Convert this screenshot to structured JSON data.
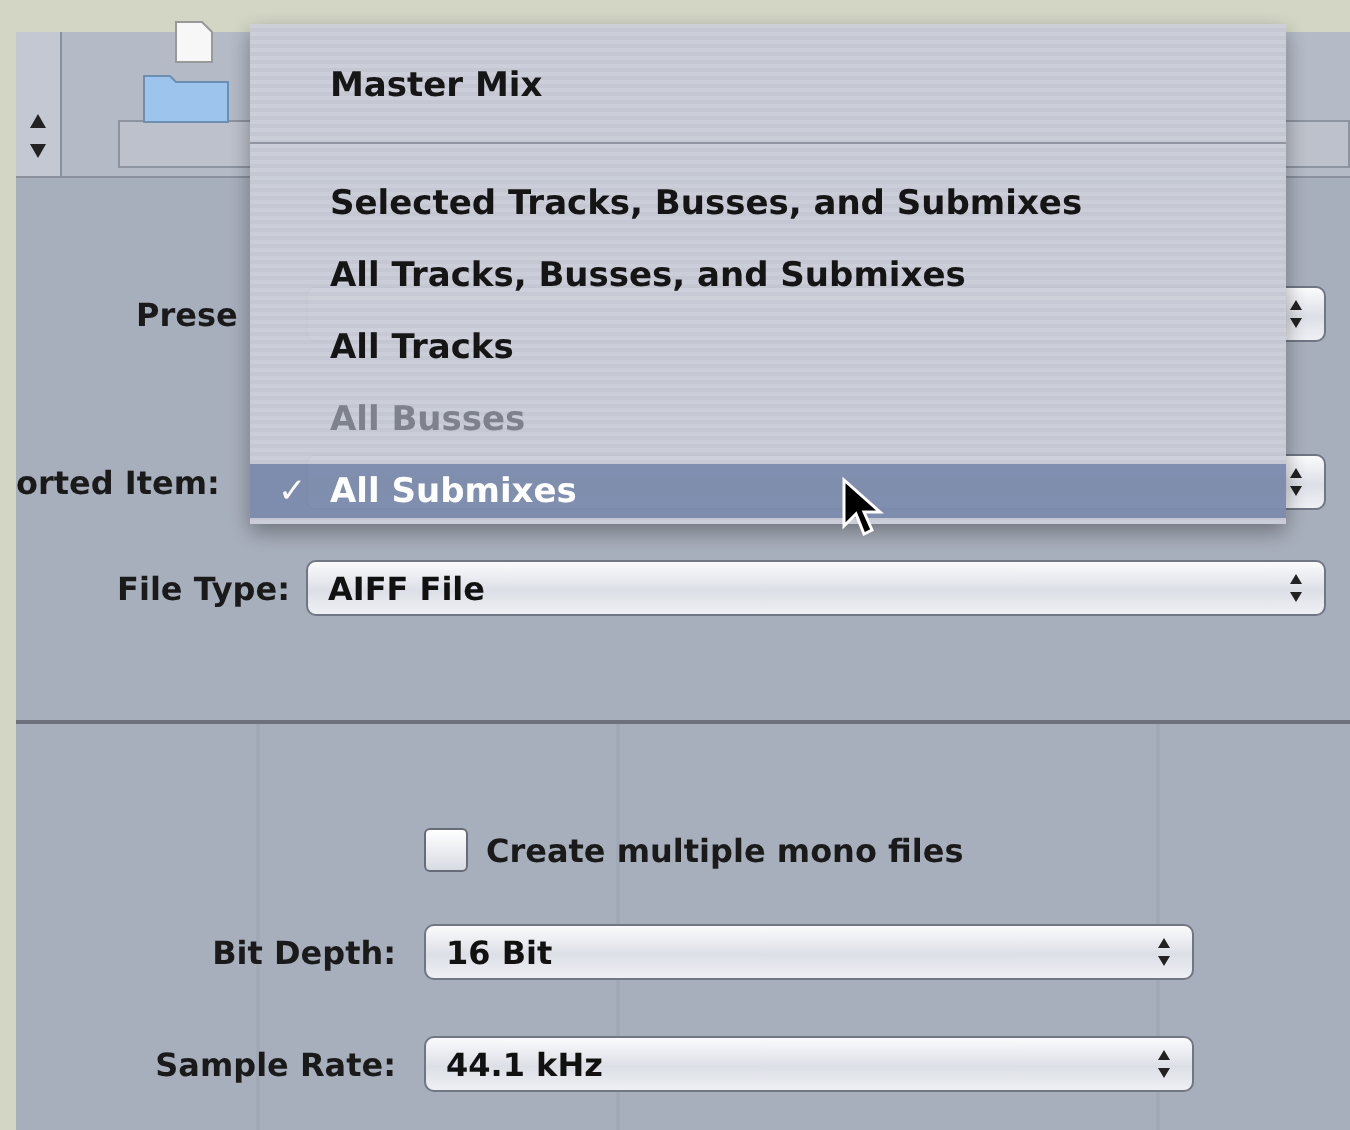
{
  "menu": {
    "items": [
      {
        "kind": "item",
        "label": "Master Mix",
        "disabled": false,
        "checked": false,
        "selected": false
      },
      {
        "kind": "separator"
      },
      {
        "kind": "item",
        "label": "Selected Tracks, Busses, and Submixes",
        "disabled": false,
        "checked": false,
        "selected": false
      },
      {
        "kind": "item",
        "label": "All Tracks, Busses, and Submixes",
        "disabled": false,
        "checked": false,
        "selected": false
      },
      {
        "kind": "item",
        "label": "All Tracks",
        "disabled": false,
        "checked": false,
        "selected": false
      },
      {
        "kind": "item",
        "label": "All Busses",
        "disabled": true,
        "checked": false,
        "selected": false
      },
      {
        "kind": "item",
        "label": "All Submixes",
        "disabled": false,
        "checked": true,
        "selected": true
      }
    ],
    "check_mark": "✓"
  },
  "export": {
    "covered_fields": [
      {
        "label": "Prese"
      },
      {
        "label": "orted Item:"
      }
    ],
    "file_type": {
      "label": "File Type:",
      "value": "AIFF File"
    }
  },
  "options": {
    "mono_files": {
      "label": "Create multiple mono files",
      "checked": false
    },
    "fields": [
      {
        "label": "Bit Depth:",
        "value": "16 Bit"
      },
      {
        "label": "Sample Rate:",
        "value": "44.1 kHz"
      }
    ]
  }
}
